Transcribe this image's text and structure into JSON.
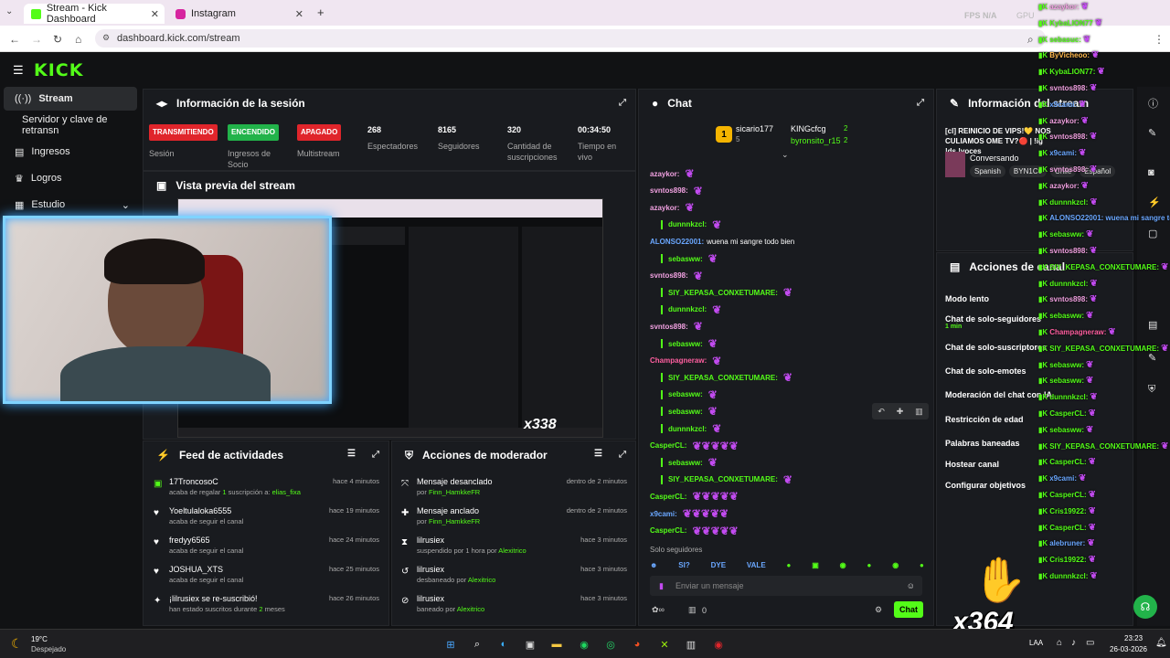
{
  "browser": {
    "tabs": [
      {
        "label": "Stream - Kick Dashboard"
      },
      {
        "label": "Instagram"
      }
    ],
    "url": "dashboard.kick.com/stream",
    "overlay_stats": "FPS  N/A",
    "overlay_gpu": "GPU"
  },
  "kick": {
    "logo": "KICK",
    "sidebar": [
      {
        "label": "Stream"
      },
      {
        "label": "Servidor y clave de retransn"
      },
      {
        "label": "Ingresos"
      },
      {
        "label": "Logros"
      },
      {
        "label": "Estudio"
      }
    ],
    "session": {
      "title": "Información de la sesión",
      "badges": [
        {
          "text": "TRANSMITIENDO",
          "label": "Sesión",
          "color": "#e0252b"
        },
        {
          "text": "ENCENDIDO",
          "label": "Ingresos de Socio",
          "color": "#22b34a"
        },
        {
          "text": "APAGADO",
          "label": "Multistream",
          "color": "#e0252b"
        }
      ],
      "stats": [
        {
          "value": "268",
          "label": "Espectadores"
        },
        {
          "value": "8165",
          "label": "Seguidores"
        },
        {
          "value": "320",
          "label": "Cantidad de suscripciones"
        },
        {
          "value": "00:34:50",
          "label": "Tiempo en vivo"
        }
      ]
    },
    "preview": {
      "title": "Vista previa del stream",
      "counter": "x338"
    },
    "feed": {
      "title": "Feed de actividades",
      "items": [
        {
          "name": "17TroncosoC",
          "sub_pre": "acaba de regalar",
          "sub_num": "1",
          "sub_mid": " suscripción a:",
          "sub_hl": "elias_fixa",
          "time": "hace 4 minutos",
          "icon": "gift-icon"
        },
        {
          "name": "Yoeltulaloka6555",
          "sub_pre": "acaba de seguir el canal",
          "sub_num": "",
          "sub_mid": "",
          "sub_hl": "",
          "time": "hace 19 minutos",
          "icon": "heart-icon"
        },
        {
          "name": "fredyy6565",
          "sub_pre": "acaba de seguir el canal",
          "sub_num": "",
          "sub_mid": "",
          "sub_hl": "",
          "time": "hace 24 minutos",
          "icon": "heart-icon"
        },
        {
          "name": "JOSHUA_XTS",
          "sub_pre": "acaba de seguir el canal",
          "sub_num": "",
          "sub_mid": "",
          "sub_hl": "",
          "time": "hace 25 minutos",
          "icon": "heart-icon"
        },
        {
          "name": "¡lilrusiex se re-suscribió!",
          "sub_pre": "han estado suscritos durante",
          "sub_num": "2",
          "sub_mid": " meses",
          "sub_hl": "",
          "time": "hace 26 minutos",
          "icon": "star-icon"
        }
      ]
    },
    "modactions": {
      "title": "Acciones de moderador",
      "items": [
        {
          "name": "Mensaje desanclado",
          "sub": "por",
          "who": "Finn_HamkkeFR",
          "time": "dentro de 2 minutos",
          "icon": "unpin-icon"
        },
        {
          "name": "Mensaje anclado",
          "sub": "por",
          "who": "Finn_HamkkeFR",
          "time": "dentro de 2 minutos",
          "icon": "pin-icon"
        },
        {
          "name": "lilrusiex",
          "sub": "suspendido por 1 hora por",
          "who": "Alexitrico",
          "time": "hace 3 minutos",
          "icon": "hourglass-icon"
        },
        {
          "name": "lilrusiex",
          "sub": "desbaneado por",
          "who": "Alexitrico",
          "time": "hace 3 minutos",
          "icon": "undo-icon"
        },
        {
          "name": "lilrusiex",
          "sub": "baneado por",
          "who": "Alexitrico",
          "time": "hace 3 minutos",
          "icon": "ban-icon"
        }
      ]
    },
    "chat": {
      "title": "Chat",
      "top_gifters": [
        {
          "name": "sicario177",
          "count": "5"
        },
        {
          "name": "KINGcfcg",
          "count": "2"
        },
        {
          "name": "byronsito_r15",
          "count": "2"
        }
      ],
      "messages": [
        {
          "user": "azaykor:",
          "color": "#f0a0e0",
          "text": ""
        },
        {
          "user": "svntos898:",
          "color": "#f0a0e0",
          "text": ""
        },
        {
          "user": "azaykor:",
          "color": "#f0a0e0",
          "text": ""
        },
        {
          "user": "dunnnkzcl:",
          "color": "#53fc18",
          "text": ""
        },
        {
          "user": "ALONSO22001:",
          "color": "#6aa7ff",
          "text": "wuena mi sangre todo bien"
        },
        {
          "user": "sebasww:",
          "color": "#53fc18",
          "text": ""
        },
        {
          "user": "svntos898:",
          "color": "#f0a0e0",
          "text": ""
        },
        {
          "user": "SIY_KEPASA_CONXETUMARE:",
          "color": "#53fc18",
          "text": ""
        },
        {
          "user": "dunnnkzcl:",
          "color": "#53fc18",
          "text": ""
        },
        {
          "user": "svntos898:",
          "color": "#f0a0e0",
          "text": ""
        },
        {
          "user": "sebasww:",
          "color": "#53fc18",
          "text": ""
        },
        {
          "user": "Champagneraw:",
          "color": "#ff5fa0",
          "text": ""
        },
        {
          "user": "SIY_KEPASA_CONXETUMARE:",
          "color": "#53fc18",
          "text": ""
        },
        {
          "user": "sebasww:",
          "color": "#53fc18",
          "text": ""
        },
        {
          "user": "sebasww:",
          "color": "#53fc18",
          "text": ""
        },
        {
          "user": "dunnnkzcl:",
          "color": "#53fc18",
          "text": ""
        },
        {
          "user": "CasperCL:",
          "color": "#53fc18",
          "text": ""
        },
        {
          "user": "sebasww:",
          "color": "#53fc18",
          "text": ""
        },
        {
          "user": "SIY_KEPASA_CONXETUMARE:",
          "color": "#53fc18",
          "text": ""
        },
        {
          "user": "CasperCL:",
          "color": "#53fc18",
          "text": ""
        },
        {
          "user": "x9cami:",
          "color": "#6aa7ff",
          "text": ""
        },
        {
          "user": "CasperCL:",
          "color": "#53fc18",
          "text": ""
        }
      ],
      "followers_only": "Solo seguidores",
      "emote_labels": [
        "SI?",
        "DYE",
        "VALE"
      ],
      "input_placeholder": "Enviar un mensaje",
      "points": "0",
      "send_label": "Chat"
    },
    "stream_info": {
      "title": "Información del stream",
      "stream_title": "[cl] REINICIO DE VIPS!💛 NOS CULIAMOS OME TV?🔴 | !ig !ds !voces",
      "category": "Conversando",
      "tags": [
        "Spanish",
        "BYN1C0",
        "Chile",
        "Español"
      ]
    },
    "channel_actions": {
      "title": "Acciones de canal",
      "items": [
        {
          "label": "Modo lento",
          "sub": ""
        },
        {
          "label": "Chat de solo-seguidores",
          "sub": "1 min"
        },
        {
          "label": "Chat de solo-suscriptores",
          "sub": ""
        },
        {
          "label": "Chat de solo-emotes",
          "sub": ""
        },
        {
          "label": "Moderación del chat con IA",
          "sub": ""
        },
        {
          "label": "Restricción de edad",
          "sub": ""
        },
        {
          "label": "Palabras baneadas",
          "sub": ""
        },
        {
          "label": "Hostear canal",
          "sub": ""
        },
        {
          "label": "Configurar objetivos",
          "sub": ""
        }
      ]
    }
  },
  "overlay_chat": [
    {
      "user": "azaykor:",
      "color": "#f0a0e0"
    },
    {
      "user": "KybaLION77",
      "color": "#53fc18"
    },
    {
      "user": "sebasuc:",
      "color": "#53fc18"
    },
    {
      "user": "ByVicheoo:",
      "color": "#ffb84d"
    },
    {
      "user": "KybaLION77:",
      "color": "#53fc18"
    },
    {
      "user": "svntos898:",
      "color": "#f0a0e0"
    },
    {
      "user": "x9cami:",
      "color": "#6aa7ff"
    },
    {
      "user": "azaykor:",
      "color": "#f0a0e0"
    },
    {
      "user": "svntos898:",
      "color": "#f0a0e0"
    },
    {
      "user": "x9cami:",
      "color": "#6aa7ff"
    },
    {
      "user": "svntos898:",
      "color": "#f0a0e0"
    },
    {
      "user": "azaykor:",
      "color": "#f0a0e0"
    },
    {
      "user": "dunnnkzcl:",
      "color": "#53fc18"
    },
    {
      "user": "ALONSO22001: wuena mi sangre todo bien",
      "color": "#6aa7ff"
    },
    {
      "user": "sebasww:",
      "color": "#53fc18"
    },
    {
      "user": "svntos898:",
      "color": "#f0a0e0"
    },
    {
      "user": "SIY_KEPASA_CONXETUMARE:",
      "color": "#53fc18"
    },
    {
      "user": "dunnnkzcl:",
      "color": "#53fc18"
    },
    {
      "user": "svntos898:",
      "color": "#f0a0e0"
    },
    {
      "user": "sebasww:",
      "color": "#53fc18"
    },
    {
      "user": "Champagneraw:",
      "color": "#ff5fa0"
    },
    {
      "user": "SIY_KEPASA_CONXETUMARE:",
      "color": "#53fc18"
    },
    {
      "user": "sebasww:",
      "color": "#53fc18"
    },
    {
      "user": "sebasww:",
      "color": "#53fc18"
    },
    {
      "user": "dunnnkzcl:",
      "color": "#53fc18"
    },
    {
      "user": "CasperCL:",
      "color": "#53fc18"
    },
    {
      "user": "sebasww:",
      "color": "#53fc18"
    },
    {
      "user": "SIY_KEPASA_CONXETUMARE:",
      "color": "#53fc18"
    },
    {
      "user": "CasperCL:",
      "color": "#53fc18"
    },
    {
      "user": "x9cami:",
      "color": "#6aa7ff"
    },
    {
      "user": "CasperCL:",
      "color": "#53fc18"
    },
    {
      "user": "Cris19922:",
      "color": "#53fc18"
    },
    {
      "user": "CasperCL:",
      "color": "#53fc18"
    },
    {
      "user": "alebruner:",
      "color": "#6aa7ff"
    },
    {
      "user": "Cris19922:",
      "color": "#53fc18"
    },
    {
      "user": "dunnnkzcl:",
      "color": "#53fc18"
    }
  ],
  "overlay_counter": "x364",
  "taskbar": {
    "weather_temp": "19°C",
    "weather_desc": "Despejado",
    "lang": "LAA",
    "time": "23:23",
    "date": "26-03-2026"
  }
}
